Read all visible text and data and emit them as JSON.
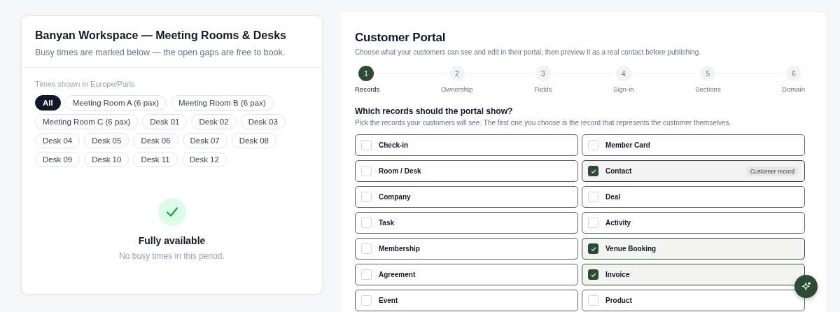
{
  "availability": {
    "title": "Banyan Workspace — Meeting Rooms & Desks",
    "subtitle": "Busy times are marked below — the open gaps are free to book.",
    "timezone_note": "Times shown in Europe/Paris",
    "filters": [
      {
        "label": "All",
        "selected": true
      },
      {
        "label": "Meeting Room A (6 pax)",
        "selected": false
      },
      {
        "label": "Meeting Room B (6 pax)",
        "selected": false
      },
      {
        "label": "Meeting Room C (6 pax)",
        "selected": false
      },
      {
        "label": "Desk 01",
        "selected": false
      },
      {
        "label": "Desk 02",
        "selected": false
      },
      {
        "label": "Desk 03",
        "selected": false
      },
      {
        "label": "Desk 04",
        "selected": false
      },
      {
        "label": "Desk 05",
        "selected": false
      },
      {
        "label": "Desk 06",
        "selected": false
      },
      {
        "label": "Desk 07",
        "selected": false
      },
      {
        "label": "Desk 08",
        "selected": false
      },
      {
        "label": "Desk 09",
        "selected": false
      },
      {
        "label": "Desk 10",
        "selected": false
      },
      {
        "label": "Desk 11",
        "selected": false
      },
      {
        "label": "Desk 12",
        "selected": false
      }
    ],
    "empty_state": {
      "title": "Fully available",
      "message": "No busy times in this period."
    }
  },
  "portal": {
    "title": "Customer Portal",
    "subtitle": "Choose what your customers can see and edit in their portal, then preview it as a real contact before publishing.",
    "steps": [
      {
        "number": "1",
        "label": "Records",
        "selected": true
      },
      {
        "number": "2",
        "label": "Ownership",
        "selected": false
      },
      {
        "number": "3",
        "label": "Fields",
        "selected": false
      },
      {
        "number": "4",
        "label": "Sign-in",
        "selected": false
      },
      {
        "number": "5",
        "label": "Sections",
        "selected": false
      },
      {
        "number": "6",
        "label": "Domain",
        "selected": false
      }
    ],
    "question": "Which records should the portal show?",
    "hint": "Pick the records your customers will see. The first one you choose is the record that represents the customer themselves.",
    "records": [
      {
        "label": "Check-in",
        "checked": false
      },
      {
        "label": "Member Card",
        "checked": false
      },
      {
        "label": "Room / Desk",
        "checked": false
      },
      {
        "label": "Contact",
        "checked": true,
        "badge": "Customer record"
      },
      {
        "label": "Company",
        "checked": false
      },
      {
        "label": "Deal",
        "checked": false
      },
      {
        "label": "Task",
        "checked": false
      },
      {
        "label": "Activity",
        "checked": false
      },
      {
        "label": "Membership",
        "checked": false
      },
      {
        "label": "Venue Booking",
        "checked": true
      },
      {
        "label": "Agreement",
        "checked": false
      },
      {
        "label": "Invoice",
        "checked": true
      },
      {
        "label": "Event",
        "checked": false
      },
      {
        "label": "Product",
        "checked": false
      }
    ]
  }
}
